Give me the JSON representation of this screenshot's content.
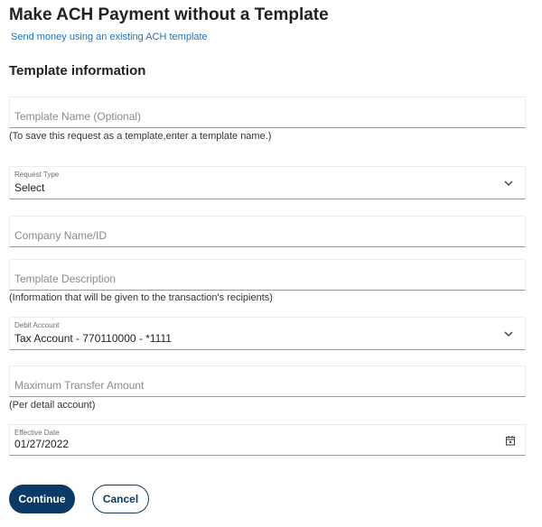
{
  "header": {
    "title": "Make ACH Payment without a Template",
    "link": "Send money using an existing ACH template"
  },
  "section": {
    "title": "Template information"
  },
  "form": {
    "template_name": {
      "placeholder": "Template Name (Optional)",
      "helper": "(To save this request as a template,enter a template name.)"
    },
    "request_type": {
      "label": "Request Type",
      "value": "Select"
    },
    "company": {
      "placeholder": "Company Name/ID"
    },
    "description": {
      "placeholder": "Template Description",
      "helper": "(Information that will be given to the transaction's recipients)"
    },
    "debit_account": {
      "label": "Debit Account",
      "value": "Tax Account - 770110000 - *1111"
    },
    "max_amount": {
      "placeholder": "Maximum Transfer Amount",
      "helper": "(Per detail account)"
    },
    "effective_date": {
      "label": "Effective Date",
      "value": "01/27/2022"
    }
  },
  "actions": {
    "continue": "Continue",
    "cancel": "Cancel"
  },
  "icons": {
    "dropdown": "chevron-down-icon",
    "date": "calendar-icon"
  },
  "colors": {
    "primary": "#0b3a66",
    "link": "#1a73c8"
  }
}
